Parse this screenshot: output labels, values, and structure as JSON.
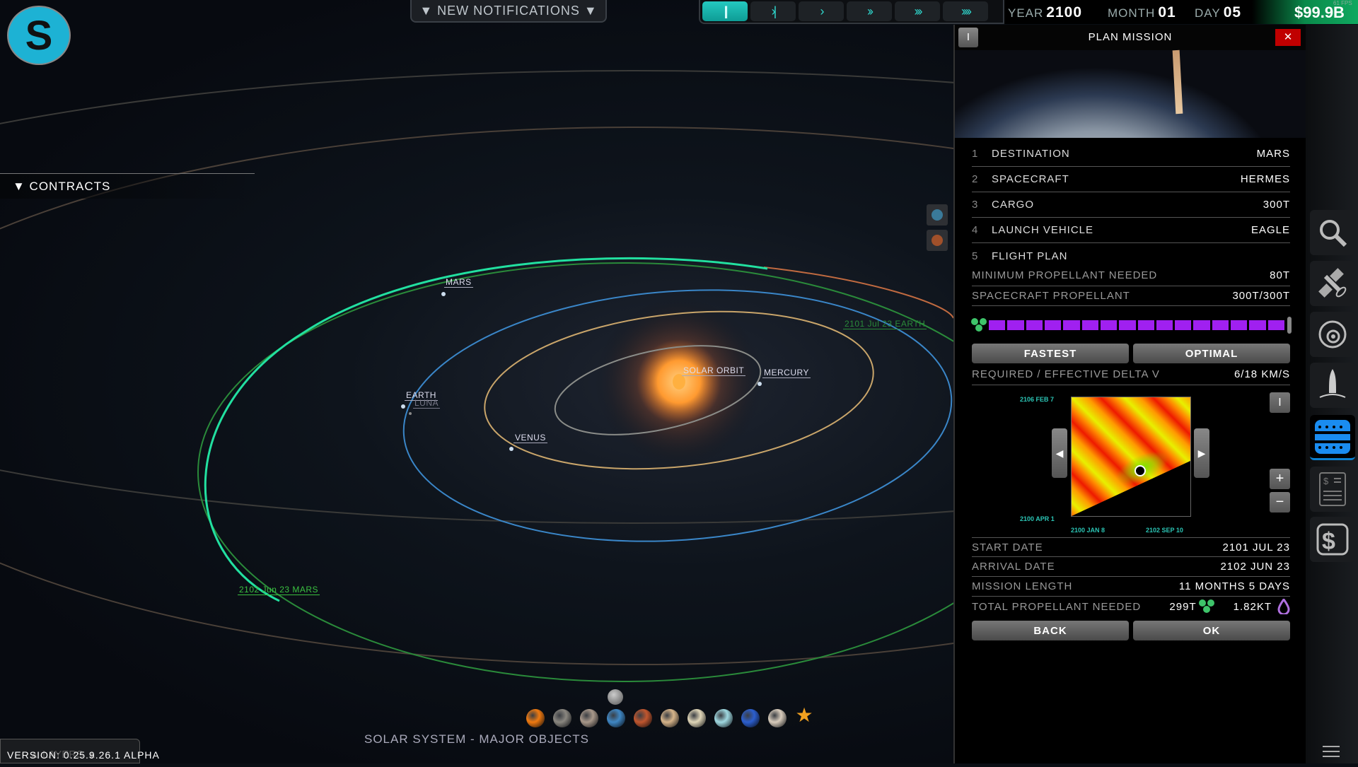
{
  "topbar": {
    "notifications_label": "▼ NEW NOTIFICATIONS ▼",
    "time_controls": [
      "||",
      "›|",
      "›",
      "››",
      "›››",
      "››››"
    ],
    "year_label": "YEAR",
    "year": "2100",
    "month_label": "MONTH",
    "month": "01",
    "day_label": "DAY",
    "day": "05",
    "money": "$99.9B",
    "fps": "61 FPS"
  },
  "logo": "S",
  "contracts": {
    "label": "▼ CONTRACTS"
  },
  "map": {
    "labels": {
      "mars": "MARS",
      "earth": "EARTH",
      "luna": "LUNA",
      "venus": "VENUS",
      "solar_orbit": "SOLAR ORBIT",
      "mercury": "MERCURY",
      "earth_departure": "2101 Jul 23 EARTH",
      "mars_arrival": "2102 Jun 23 MARS"
    }
  },
  "bottom": {
    "title": "SOLAR SYSTEM - MAJOR OBJECTS",
    "layers": "▲ LAYERS ▲",
    "version": "VERSION: 0.25.9.26.1 ALPHA",
    "planets": [
      "sun",
      "mercury",
      "venus",
      "earth",
      "mars",
      "jupiter",
      "saturn",
      "uranus",
      "neptune",
      "pluto",
      "favorites"
    ],
    "planet_colors": [
      "#f07a10",
      "#8a8780",
      "#a8988a",
      "#3f87c4",
      "#c0562e",
      "#d6b48a",
      "#e0d6b8",
      "#9fd8e0",
      "#2c5fcf",
      "#d8ccbc",
      "#f0a020"
    ]
  },
  "panel": {
    "title": "PLAN MISSION",
    "info": "i",
    "close": "✕",
    "steps": [
      {
        "n": "1",
        "label": "DESTINATION",
        "value": "MARS"
      },
      {
        "n": "2",
        "label": "SPACECRAFT",
        "value": "HERMES"
      },
      {
        "n": "3",
        "label": "CARGO",
        "value": "300T"
      },
      {
        "n": "4",
        "label": "LAUNCH VEHICLE",
        "value": "EAGLE"
      },
      {
        "n": "5",
        "label": "FLIGHT PLAN",
        "value": ""
      }
    ],
    "min_propellant_label": "MINIMUM PROPELLANT NEEDED",
    "min_propellant": "80T",
    "sc_propellant_label": "SPACECRAFT PROPELLANT",
    "sc_propellant": "300T/300T",
    "propellant_fill": 1.0,
    "fastest": "FASTEST",
    "optimal": "OPTIMAL",
    "delta_v_label": "REQUIRED / EFFECTIVE DELTA V",
    "delta_v": "6/18 KM/S",
    "porkchop": {
      "y_top": "2106 FEB 7",
      "y_bottom": "2100 APR 1",
      "x_left": "2100 JAN 8",
      "x_right": "2102 SEP 10",
      "info": "i",
      "zoom_in": "+",
      "zoom_out": "−"
    },
    "start_label": "START DATE",
    "start": "2101 JUL 23",
    "arrival_label": "ARRIVAL DATE",
    "arrival": "2102 JUN 23",
    "length_label": "MISSION LENGTH",
    "length": "11 MONTHS 5 DAYS",
    "total_label": "TOTAL PROPELLANT NEEDED",
    "total_t": "299T",
    "total_kt": "1.82KT",
    "back": "BACK",
    "ok": "OK"
  },
  "colors": {
    "accent": "#2fd6cc",
    "propellant": "#a020f0",
    "close": "#c00000",
    "money": "#17c46a"
  }
}
